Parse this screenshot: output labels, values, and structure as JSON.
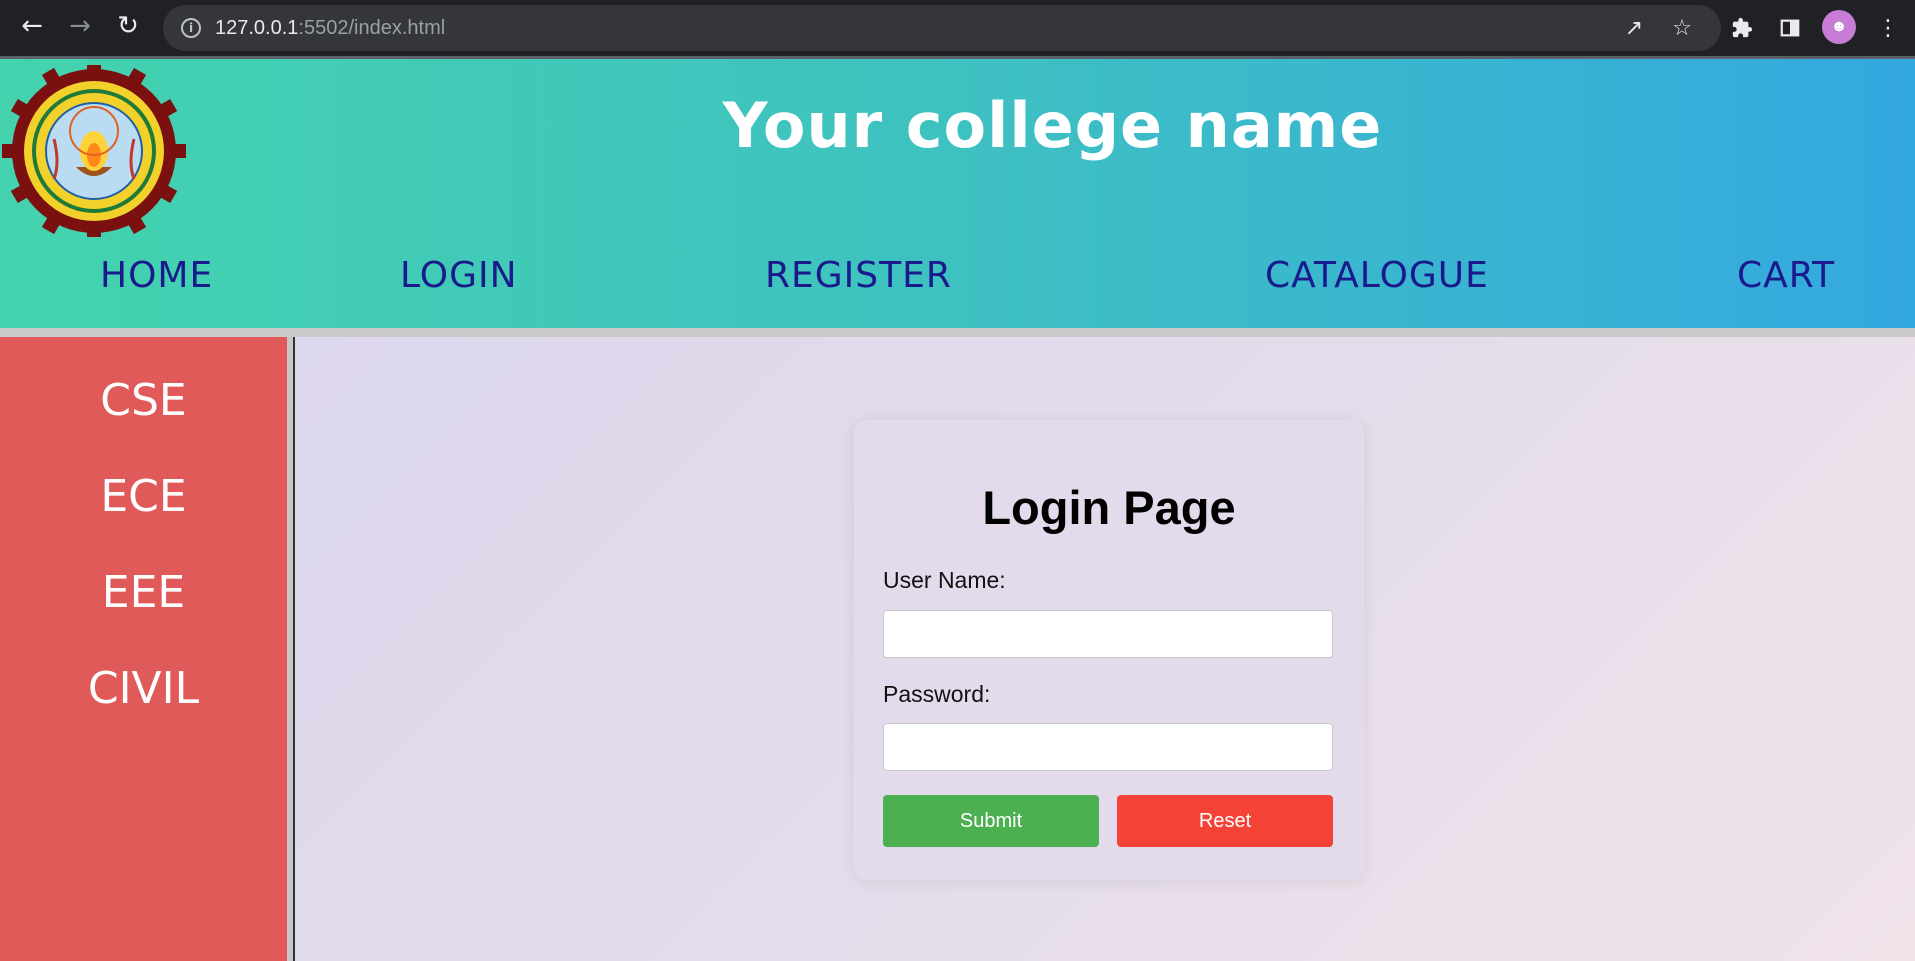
{
  "browser": {
    "url_host": "127.0.0.1",
    "url_path": ":5502/index.html",
    "icons": {
      "back": "back-arrow-icon",
      "forward": "forward-arrow-icon",
      "reload": "reload-icon",
      "info": "site-info-icon",
      "share": "share-icon",
      "star": "bookmark-star-icon",
      "extensions": "puzzle-icon",
      "side_panel": "side-panel-icon",
      "menu": "kebab-menu-icon"
    }
  },
  "header": {
    "title": "Your college name",
    "logo_alt": "university emblem logo",
    "nav": [
      "HOME",
      "LOGIN",
      "REGISTER",
      "CATALOGUE",
      "CART"
    ]
  },
  "sidebar": {
    "items": [
      "CSE",
      "ECE",
      "EEE",
      "CIVIL"
    ]
  },
  "login": {
    "title": "Login Page",
    "username_label": "User Name:",
    "username_value": "",
    "password_label": "Password:",
    "password_value": "",
    "submit_label": "Submit",
    "reset_label": "Reset"
  },
  "colors": {
    "header_gradient_start": "#44d3ae",
    "header_gradient_end": "#34a8e0",
    "nav_text": "#1a1a8c",
    "sidebar_bg": "#e05a5a",
    "submit_bg": "#4caf50",
    "reset_bg": "#f44336"
  }
}
